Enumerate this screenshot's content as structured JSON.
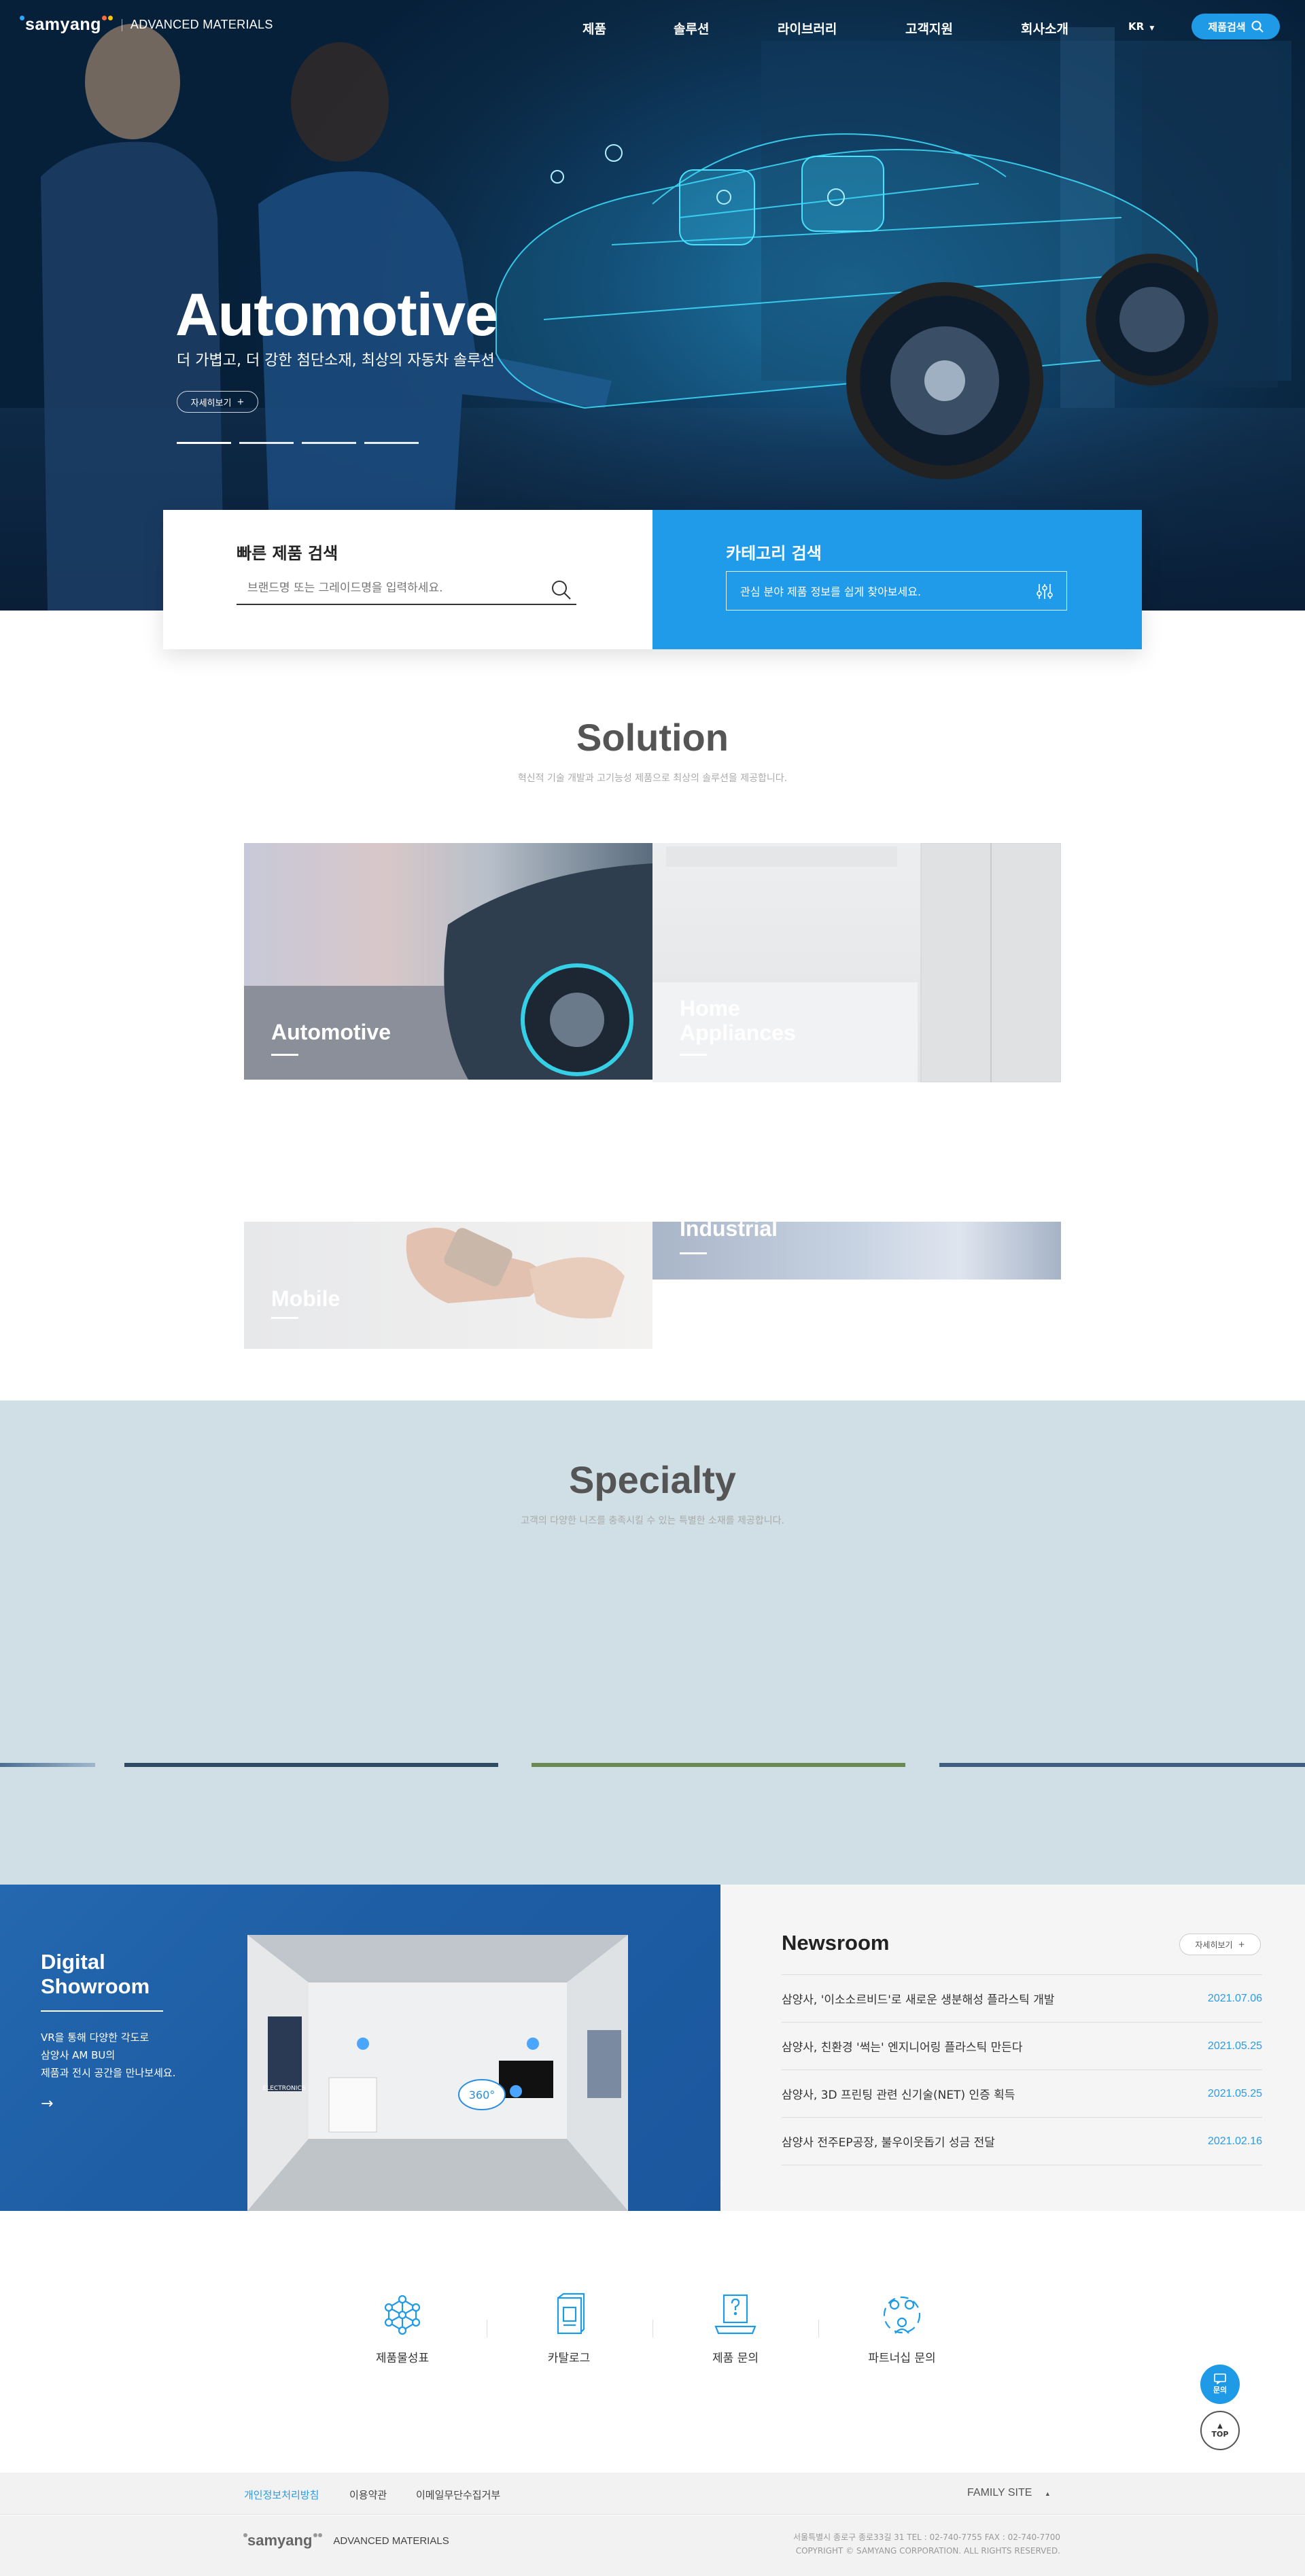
{
  "header": {
    "brand": "samyang",
    "sub": "ADVANCED MATERIALS",
    "nav": [
      "제품",
      "솔루션",
      "라이브러리",
      "고객지원",
      "회사소개"
    ],
    "lang": "KR",
    "search_label": "제품검색"
  },
  "hero": {
    "title": "Automotive",
    "subtitle": "더 가볍고, 더 강한 첨단소재, 최상의 자동차 솔루션",
    "more_label": "자세히보기",
    "slide_count": 4,
    "active_slide": 1
  },
  "quick_search": {
    "title": "빠른 제품 검색",
    "placeholder": "브랜드명 또는 그레이드명을 입력하세요."
  },
  "category_search": {
    "title": "카테고리 검색",
    "field_text": "관심 분야 제품 정보를 쉽게 찾아보세요."
  },
  "solution": {
    "title": "Solution",
    "subtitle": "혁신적 기술 개발과 고기능성 제품으로 최상의 솔루션을 제공합니다.",
    "cards": [
      {
        "label": "Automotive"
      },
      {
        "label_line1": "Home",
        "label_line2": "Appliances"
      },
      {
        "label": "Mobile"
      },
      {
        "label": "Industrial"
      }
    ]
  },
  "specialty": {
    "title": "Specialty",
    "subtitle": "고객의 다양한 니즈를 충족시킬 수 있는 특별한 소재를 제공합니다."
  },
  "showroom": {
    "title": "Digital Showroom",
    "desc": [
      "VR을 통해 다양한 각도로",
      "삼양사 AM BU의",
      "제품과 전시 공간을 만나보세요."
    ],
    "arrow": "→",
    "badge": "360°",
    "poster_label": "ELECTRONICS"
  },
  "news": {
    "title": "Newsroom",
    "more_label": "자세히보기",
    "items": [
      {
        "title": "삼양사, '이소소르비드'로 새로운 생분해성 플라스틱 개발",
        "date": "2021.07.06"
      },
      {
        "title": "삼양사, 친환경 '썩는' 엔지니어링 플라스틱 만든다",
        "date": "2021.05.25"
      },
      {
        "title": "삼양사, 3D 프린팅 관련 신기술(NET) 인증 획득",
        "date": "2021.05.25"
      },
      {
        "title": "삼양사 전주EP공장, 불우이웃돕기 성금 전달",
        "date": "2021.02.16"
      }
    ]
  },
  "quick_links": [
    {
      "label": "제품물성표",
      "icon": "molecule-icon"
    },
    {
      "label": "카탈로그",
      "icon": "catalog-icon"
    },
    {
      "label": "제품 문의",
      "icon": "question-icon"
    },
    {
      "label": "파트너십 문의",
      "icon": "partnership-icon"
    }
  ],
  "floating": {
    "inquiry": "문의",
    "top": "TOP"
  },
  "footer": {
    "links": [
      "개인정보처리방침",
      "이용약관",
      "이메일무단수집거부"
    ],
    "family_site": "FAMILY SITE",
    "brand": "samyang",
    "sub": "ADVANCED MATERIALS",
    "address": "서울특별시 종로구 종로33길 31    TEL : 02-740-7755    FAX : 02-740-7700",
    "copyright": "COPYRIGHT © SAMYANG CORPORATION. ALL RIGHTS RESERVED."
  },
  "colors": {
    "accent": "#1e9ae6",
    "specialty_bg": "#d0dfe6",
    "showroom_bg": "#1e5ea5",
    "news_date": "#2a9be6"
  }
}
